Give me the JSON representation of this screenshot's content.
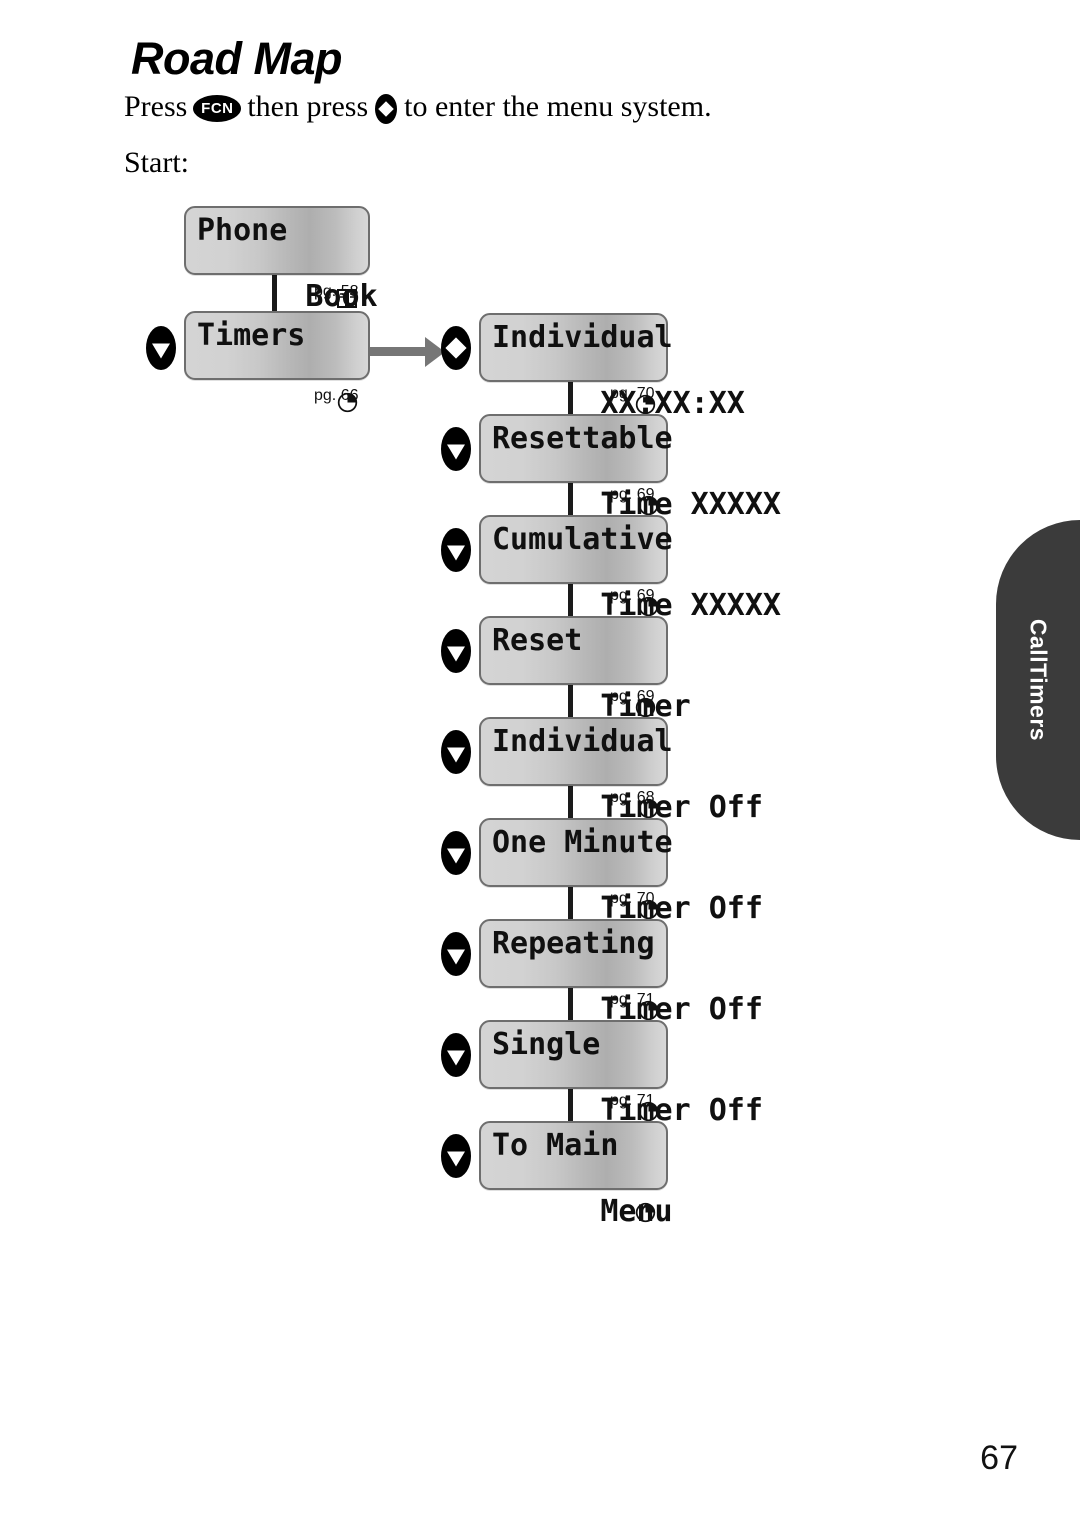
{
  "page": {
    "title": "Road Map",
    "folio": "67",
    "side_tab_label": "CallTimers"
  },
  "instruction": {
    "before_key": "Press",
    "key_label": "FCN",
    "middle": "then press",
    "after_key": "to enter the menu system.",
    "start_label": "Start:"
  },
  "left_column": [
    {
      "name": "phone-book",
      "line1": "Phone",
      "line2": "Book",
      "glyph": "book-icon",
      "page_ref": "pg. 58",
      "nav_key": "none"
    },
    {
      "name": "timers",
      "line1": "Timers",
      "line2": "",
      "glyph": "clock-icon",
      "page_ref": "pg. 66",
      "nav_key": "down"
    }
  ],
  "right_column": [
    {
      "name": "individual",
      "line1": "Individual",
      "line2": "XX:XX:XX",
      "glyph": "clock-icon",
      "page_ref": "pg. 70",
      "nav_key": "diamond"
    },
    {
      "name": "resettable-time",
      "line1": "Resettable",
      "line2": "Time XXXXX",
      "glyph": "clock-icon",
      "page_ref": "pg. 69",
      "nav_key": "down"
    },
    {
      "name": "cumulative-time",
      "line1": "Cumulative",
      "line2": "Time XXXXX",
      "glyph": "clock-icon",
      "page_ref": "pg. 69",
      "nav_key": "down"
    },
    {
      "name": "reset-timer",
      "line1": "Reset",
      "line2": "Timer",
      "glyph": "clock-icon",
      "page_ref": "pg. 69",
      "nav_key": "down"
    },
    {
      "name": "individual-timer-off",
      "line1": "Individual",
      "line2": "Timer Off",
      "glyph": "clock-icon",
      "page_ref": "pg. 68",
      "nav_key": "down"
    },
    {
      "name": "one-minute-timer-off",
      "line1": "One Minute",
      "line2": "Timer Off",
      "glyph": "clock-icon",
      "page_ref": "pg. 70",
      "nav_key": "down"
    },
    {
      "name": "repeating-timer-off",
      "line1": "Repeating",
      "line2": "Timer Off",
      "glyph": "clock-icon",
      "page_ref": "pg. 71",
      "nav_key": "down"
    },
    {
      "name": "single-timer-off",
      "line1": "Single",
      "line2": "Timer Off",
      "glyph": "clock-icon",
      "page_ref": "pg. 71",
      "nav_key": "down"
    },
    {
      "name": "to-main-menu",
      "line1": "To Main",
      "line2": "Menu",
      "glyph": "clock-icon",
      "page_ref": "",
      "nav_key": "down"
    }
  ],
  "colors": {
    "lcd_border": "#6e6e6e",
    "lcd_bg_light": "#d4d4d4",
    "lcd_bg_dark": "#aeaeae",
    "connector": "#1a1a1a",
    "arrow": "#767676",
    "tab_bg": "#3b3b3b",
    "key_bg": "#000000"
  }
}
